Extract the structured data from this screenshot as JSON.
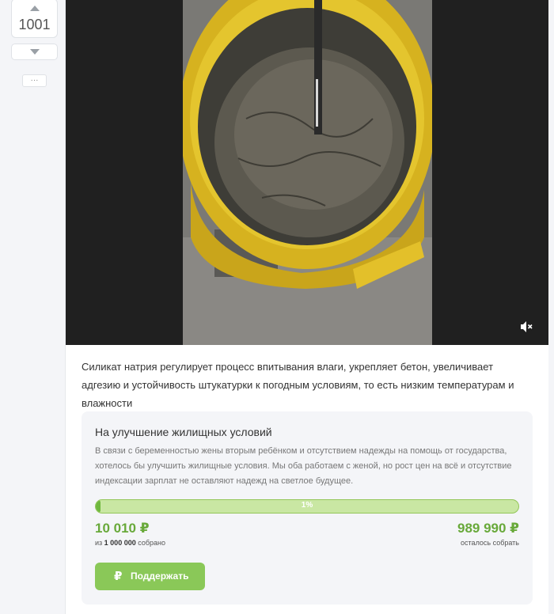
{
  "rating": {
    "count": "1001",
    "more_label": "···"
  },
  "video": {
    "mute_icon": "volume-mute-icon"
  },
  "post": {
    "description": "Силикат натрия регулирует процесс впитывания влаги, укрепляет бетон, увеличивает адгезию и устойчивость штукатурки к погодным условиям, то есть низким температурам и влажности"
  },
  "donation": {
    "title": "На улучшение жилищных условий",
    "text": "В связи с беременностью жены вторым ребёнком и отсутствием надежды на помощь от государства, хотелось бы улучшить жилищные условия. Мы оба работаем с женой, но рост цен на всё и отсутствие индексации зарплат не оставляют надежд на светлое будущее.",
    "progress_percent": 1,
    "progress_label": "1%",
    "collected": "10 010 ₽",
    "goal_prefix": "из",
    "goal": "1 000 000",
    "goal_suffix": "собрано",
    "remaining": "989 990 ₽",
    "remaining_caption": "осталось собрать",
    "button_label": "Поддержать",
    "button_icon": "₽"
  },
  "colors": {
    "accent_green": "#68a93a",
    "button_green": "#8ac858",
    "progress_bg": "#c9e7a3"
  }
}
